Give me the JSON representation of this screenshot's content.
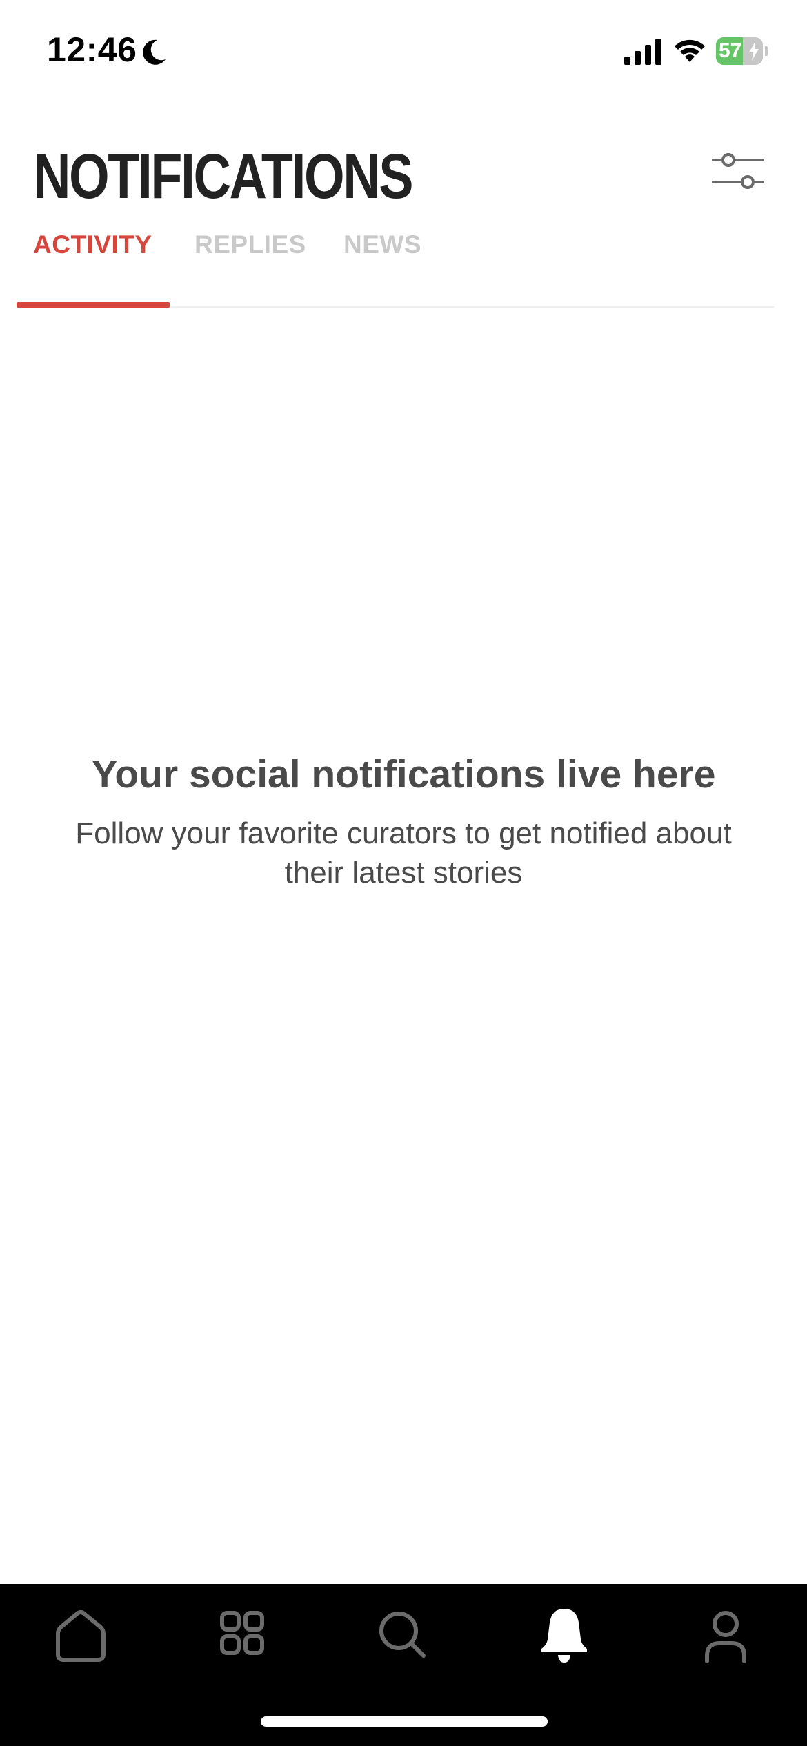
{
  "status_bar": {
    "time": "12:46",
    "battery_percent": "57",
    "battery_level": 0.57,
    "icons": [
      "moon-icon",
      "cellular-signal-icon",
      "wifi-icon",
      "battery-charging-icon"
    ]
  },
  "header": {
    "title": "NOTIFICATIONS",
    "filter_icon": "sliders-icon"
  },
  "tabs": [
    {
      "label": "ACTIVITY",
      "selected": true
    },
    {
      "label": "REPLIES",
      "selected": false
    },
    {
      "label": "NEWS",
      "selected": false
    }
  ],
  "empty_state": {
    "title": "Your social notifications live here",
    "subtitle": "Follow your favorite curators to get notified about their latest stories"
  },
  "nav": {
    "items": [
      {
        "icon": "home-icon",
        "active": false
      },
      {
        "icon": "grid-icon",
        "active": false
      },
      {
        "icon": "search-icon",
        "active": false
      },
      {
        "icon": "bell-icon",
        "active": true
      },
      {
        "icon": "profile-icon",
        "active": false
      }
    ]
  },
  "colors": {
    "accent": "#d8453a",
    "title": "#222222",
    "inactive_tab": "#c9c9c9",
    "body_text": "#4a4a4a",
    "tab_bar": "#000000",
    "battery_green": "#65c466"
  }
}
